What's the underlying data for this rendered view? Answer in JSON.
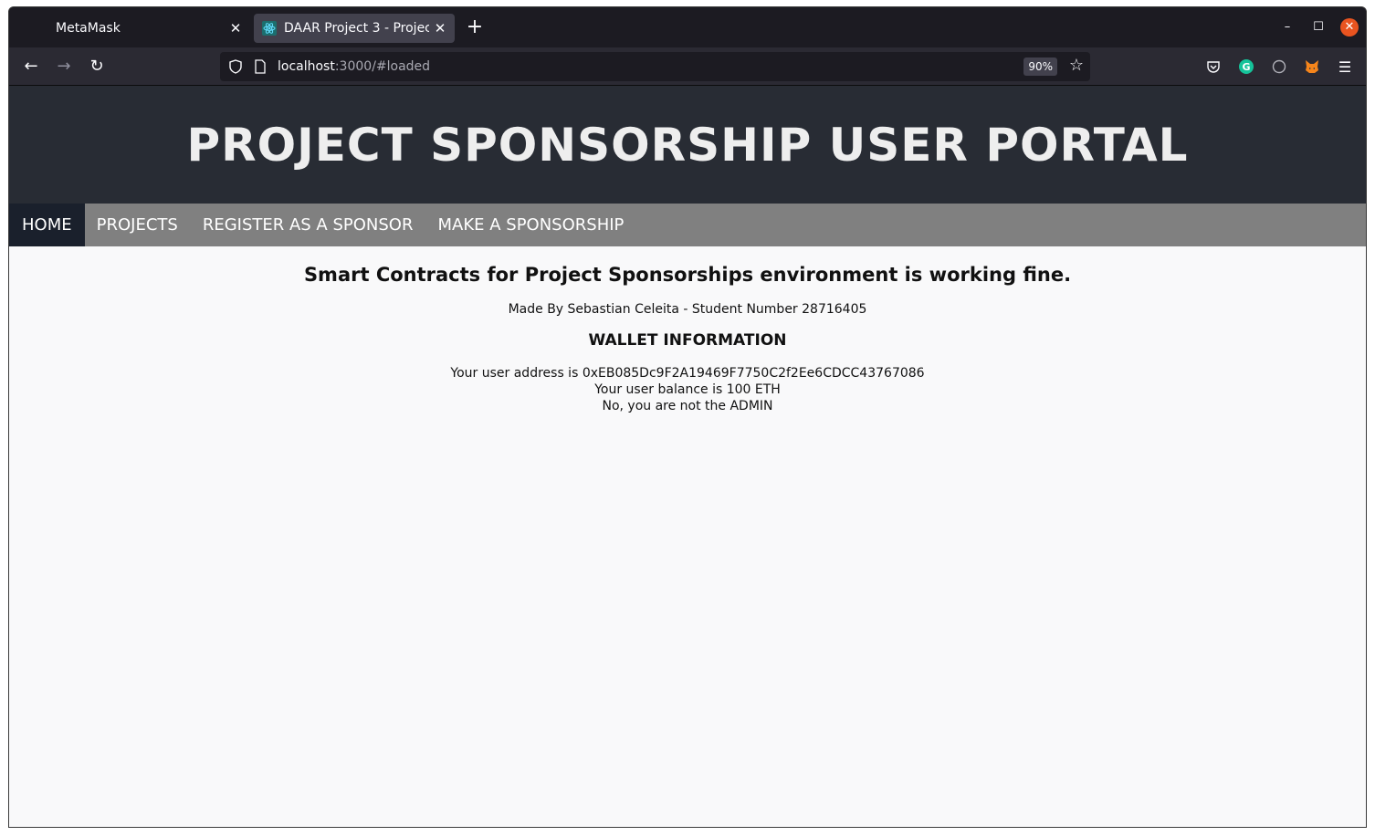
{
  "browser": {
    "tabs": [
      {
        "title": "MetaMask",
        "active": false
      },
      {
        "title": "DAAR Project 3 - Project",
        "active": true
      }
    ],
    "url_host": "localhost",
    "url_rest": ":3000/#loaded",
    "zoom": "90%"
  },
  "page": {
    "title": "PROJECT SPONSORSHIP USER PORTAL",
    "nav": {
      "home": "HOME",
      "projects": "PROJECTS",
      "register": "REGISTER AS A SPONSOR",
      "sponsorship": "MAKE A SPONSORSHIP"
    },
    "status": "Smart Contracts for Project Sponsorships environment is working fine.",
    "credit": "Made By Sebastian Celeita - Student Number 28716405",
    "wallet_heading": "WALLET INFORMATION",
    "address_line": "Your user address is 0xEB085Dc9F2A19469F7750C2f2Ee6CDCC43767086",
    "balance_line": "Your user balance is 100 ETH",
    "admin_line": "No, you are not the ADMIN"
  },
  "colors": {
    "hero_bg": "#282c34",
    "nav_bg": "#808080",
    "nav_active_bg": "#1a202c"
  }
}
